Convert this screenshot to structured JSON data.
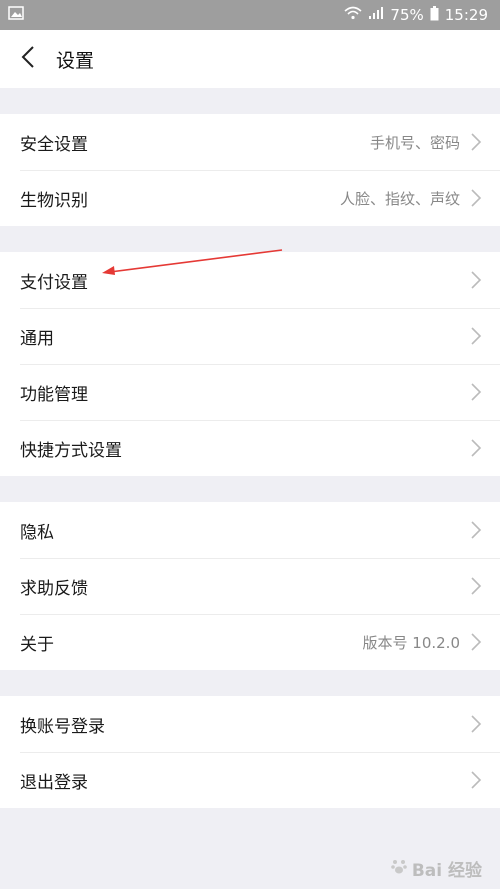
{
  "status_bar": {
    "battery": "75%",
    "time": "15:29"
  },
  "header": {
    "title": "设置"
  },
  "groups": [
    {
      "items": [
        {
          "label": "安全设置",
          "hint": "手机号、密码"
        },
        {
          "label": "生物识别",
          "hint": "人脸、指纹、声纹"
        }
      ]
    },
    {
      "items": [
        {
          "label": "支付设置",
          "hint": ""
        },
        {
          "label": "通用",
          "hint": ""
        },
        {
          "label": "功能管理",
          "hint": ""
        },
        {
          "label": "快捷方式设置",
          "hint": ""
        }
      ]
    },
    {
      "items": [
        {
          "label": "隐私",
          "hint": ""
        },
        {
          "label": "求助反馈",
          "hint": ""
        },
        {
          "label": "关于",
          "hint": "版本号 10.2.0"
        }
      ]
    },
    {
      "items": [
        {
          "label": "换账号登录",
          "hint": ""
        },
        {
          "label": "退出登录",
          "hint": ""
        }
      ]
    }
  ],
  "watermark": {
    "text": "Bai 经验"
  },
  "colors": {
    "annotation_arrow": "#e53935",
    "status_bar": "#9e9e9e"
  }
}
